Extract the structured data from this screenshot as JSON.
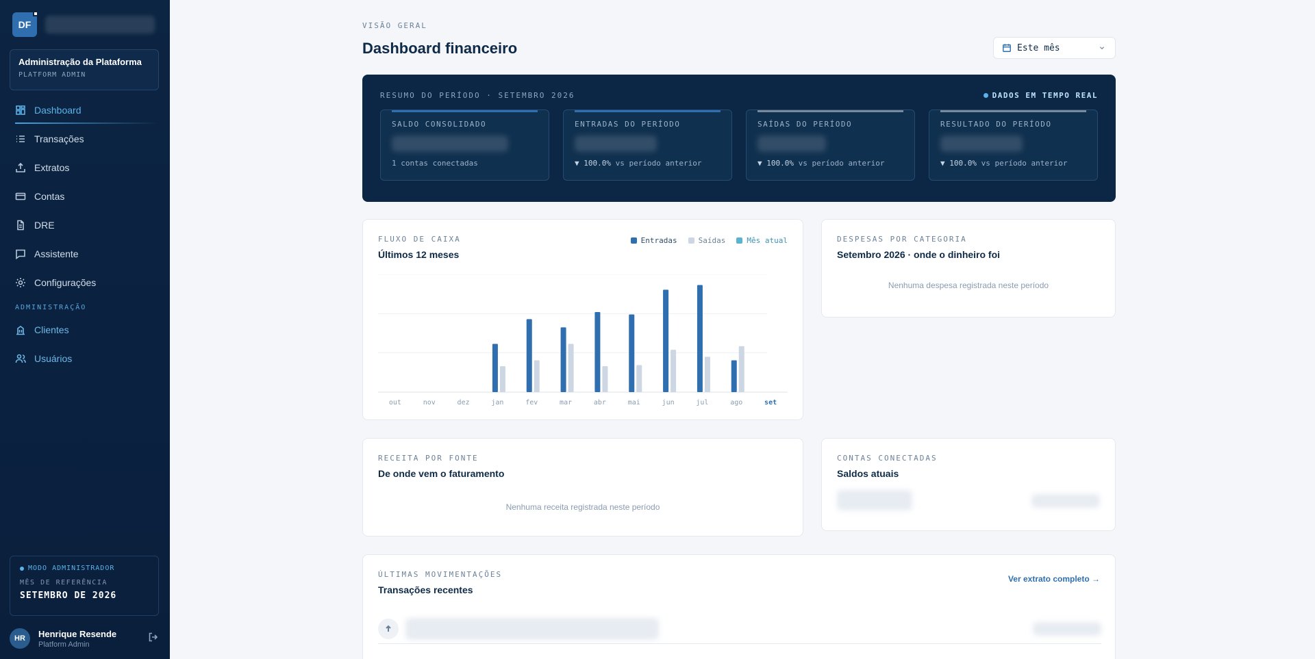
{
  "sidebar": {
    "logo": "DF",
    "tenant_name": "Administração da Plataforma",
    "tenant_role": "PLATFORM ADMIN",
    "nav": [
      {
        "label": "Dashboard"
      },
      {
        "label": "Transações"
      },
      {
        "label": "Extratos"
      },
      {
        "label": "Contas"
      },
      {
        "label": "DRE"
      },
      {
        "label": "Assistente"
      },
      {
        "label": "Configurações"
      }
    ],
    "admin_section": "ADMINISTRAÇÃO",
    "admin_nav": [
      {
        "label": "Clientes"
      },
      {
        "label": "Usuários"
      }
    ],
    "admin_mode": "MODO ADMINISTRADOR",
    "ref_label": "MÊS DE REFERÊNCIA",
    "ref_value": "SETEMBRO DE 2026",
    "user_initials": "HR",
    "user_name": "Henrique Resende",
    "user_role": "Platform Admin"
  },
  "header": {
    "eyebrow": "VISÃO GERAL",
    "title": "Dashboard financeiro",
    "period": "Este mês"
  },
  "summary": {
    "eyebrow": "RESUMO DO PERÍODO · SETEMBRO 2026",
    "live": "DADOS EM TEMPO REAL",
    "kpis": [
      {
        "label": "SALDO CONSOLIDADO",
        "sub": "1 contas conectadas",
        "accent": "#2f6fb0"
      },
      {
        "label": "ENTRADAS DO PERÍODO",
        "delta": "▼ 100.0%",
        "sub": "vs período anterior",
        "accent": "#2f6fb0"
      },
      {
        "label": "SAÍDAS DO PERÍODO",
        "delta": "▼ 100.0%",
        "sub": "vs período anterior",
        "accent": "#7a8a9a"
      },
      {
        "label": "RESULTADO DO PERÍODO",
        "delta": "▼ 100.0%",
        "sub": "vs período anterior",
        "accent": "#7a8a9a"
      }
    ]
  },
  "cashflow": {
    "eyebrow": "FLUXO DE CAIXA",
    "title": "Últimos 12 meses",
    "legend": {
      "in": "Entradas",
      "out": "Saídas",
      "current": "Mês atual"
    }
  },
  "chart_data": {
    "type": "bar",
    "categories": [
      "out",
      "nov",
      "dez",
      "jan",
      "fev",
      "mar",
      "abr",
      "mai",
      "jun",
      "jul",
      "ago",
      "set"
    ],
    "series": [
      {
        "name": "Entradas",
        "values": [
          0,
          0,
          0,
          41,
          62,
          55,
          68,
          66,
          87,
          91,
          27,
          0
        ]
      },
      {
        "name": "Saídas",
        "values": [
          0,
          0,
          0,
          22,
          27,
          41,
          22,
          23,
          36,
          30,
          39,
          0
        ]
      }
    ],
    "ylim": [
      0,
      100
    ],
    "highlight_category": "set",
    "colors": {
      "in": "#2f6fb0",
      "out": "#ccd7e3",
      "current": "#5ab3d0"
    }
  },
  "expenses": {
    "eyebrow": "DESPESAS POR CATEGORIA",
    "title": "Setembro 2026 · onde o dinheiro foi",
    "empty": "Nenhuma despesa registrada neste período"
  },
  "revenue": {
    "eyebrow": "RECEITA POR FONTE",
    "title": "De onde vem o faturamento",
    "empty": "Nenhuma receita registrada neste período"
  },
  "accounts": {
    "eyebrow": "CONTAS CONECTADAS",
    "title": "Saldos atuais"
  },
  "transactions": {
    "eyebrow": "ÚLTIMAS MOVIMENTAÇÕES",
    "title": "Transações recentes",
    "link": "Ver extrato completo →"
  }
}
